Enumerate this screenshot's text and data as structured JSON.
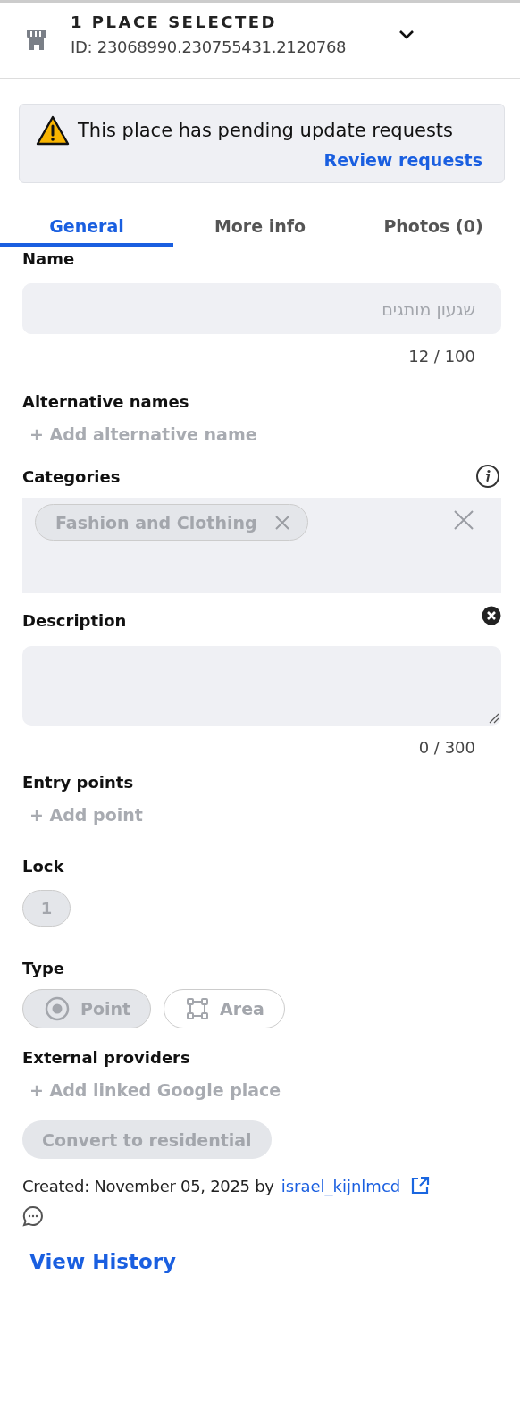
{
  "header": {
    "title": "1 PLACE SELECTED",
    "id": "ID: 23068990.230755431.2120768"
  },
  "alert": {
    "message": "This place has pending update requests",
    "action": "Review requests"
  },
  "tabs": [
    {
      "label": "General",
      "selected": true
    },
    {
      "label": "More info",
      "selected": false
    },
    {
      "label": "Photos (0)",
      "selected": false
    }
  ],
  "name": {
    "label": "Name",
    "value": "שגעון מותגים",
    "counter": "12 / 100",
    "disabled": true
  },
  "alternative_names": {
    "label": "Alternative names",
    "add": "+ Add alternative name",
    "disabled": true
  },
  "categories": {
    "label": "Categories",
    "chips": [
      "Fashion and Clothing"
    ]
  },
  "description": {
    "label": "Description",
    "counter": "0 / 300"
  },
  "entry_points": {
    "label": "Entry points",
    "add": "+ Add point",
    "disabled": true
  },
  "lock": {
    "label": "Lock",
    "value": "1"
  },
  "type": {
    "label": "Type",
    "options": [
      {
        "kind": "point",
        "label": "Point",
        "selected": true
      },
      {
        "kind": "area",
        "label": "Area",
        "selected": false
      }
    ]
  },
  "external_providers": {
    "label": "External providers",
    "add": "+ Add linked Google place",
    "disabled": true
  },
  "convert_button": {
    "label": "Convert to residential",
    "disabled": true
  },
  "created": {
    "text": "Created: November 05, 2025 by",
    "user": "israel_kijnlmcd"
  },
  "view_history": "View History"
}
